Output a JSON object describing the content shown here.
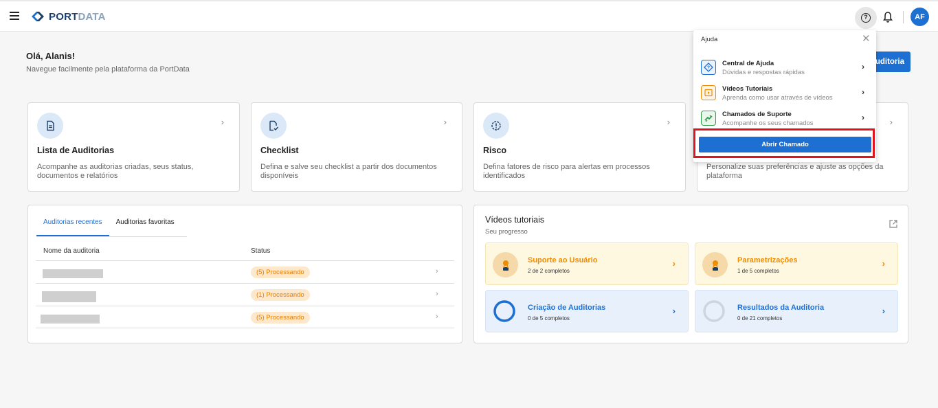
{
  "header": {
    "logo_port": "PORT",
    "logo_data": "DATA",
    "avatar_initials": "AF"
  },
  "greeting": {
    "title": "Olá, Alanis!",
    "subtitle": "Navegue facilmente pela plataforma da PortData",
    "new_audit_label": "uditoria"
  },
  "cards": [
    {
      "title": "Lista de Auditorias",
      "desc": "Acompanhe as auditorias criadas, seus status, documentos e relatórios",
      "icon": "document-icon"
    },
    {
      "title": "Checklist",
      "desc": "Defina e salve seu checklist a partir dos documentos disponíveis",
      "icon": "checklist-icon"
    },
    {
      "title": "Risco",
      "desc": "Defina fatores de risco para alertas em processos identificados",
      "icon": "risk-alert-icon"
    },
    {
      "title": "",
      "desc": "Personalize suas preferências e ajuste as opções da plataforma",
      "icon": "settings-icon"
    }
  ],
  "audits": {
    "tabs": [
      "Auditorias recentes",
      "Auditorias favoritas"
    ],
    "columns": [
      "Nome da auditoria",
      "Status"
    ],
    "rows": [
      {
        "name": "",
        "status": "(5) Processando"
      },
      {
        "name": "",
        "status": "(1) Processando"
      },
      {
        "name": "",
        "status": "(5) Processando"
      }
    ]
  },
  "videos": {
    "title": "Vídeos tutoriais",
    "subtitle": "Seu progresso",
    "items": [
      {
        "title": "Suporte ao Usuário",
        "progress": "2 de 2 completos",
        "completed": 2,
        "total": 2
      },
      {
        "title": "Parametrizações",
        "progress": "1 de 5 completos",
        "completed": 1,
        "total": 5
      },
      {
        "title": "Criação de Auditorias",
        "progress": "0 de 5 completos",
        "completed": 0,
        "total": 5
      },
      {
        "title": "Resultados da Auditoria",
        "progress": "0 de 21 completos",
        "completed": 0,
        "total": 21
      }
    ]
  },
  "help_menu": {
    "title": "Ajuda",
    "items": [
      {
        "title": "Central de Ajuda",
        "subtitle": "Dúvidas e respostas rápidas",
        "icon": "help-center-icon"
      },
      {
        "title": "Vídeos Tutoriais",
        "subtitle": "Aprenda como usar através de vídeos",
        "icon": "video-icon"
      },
      {
        "title": "Chamados de Suporte",
        "subtitle": "Acompanhe os seus chamados",
        "icon": "support-ticket-icon"
      }
    ],
    "cta_label": "Abrir Chamado"
  },
  "colors": {
    "primary": "#1e6fd2",
    "warning": "#ef8c00",
    "highlight": "#e0141e"
  }
}
